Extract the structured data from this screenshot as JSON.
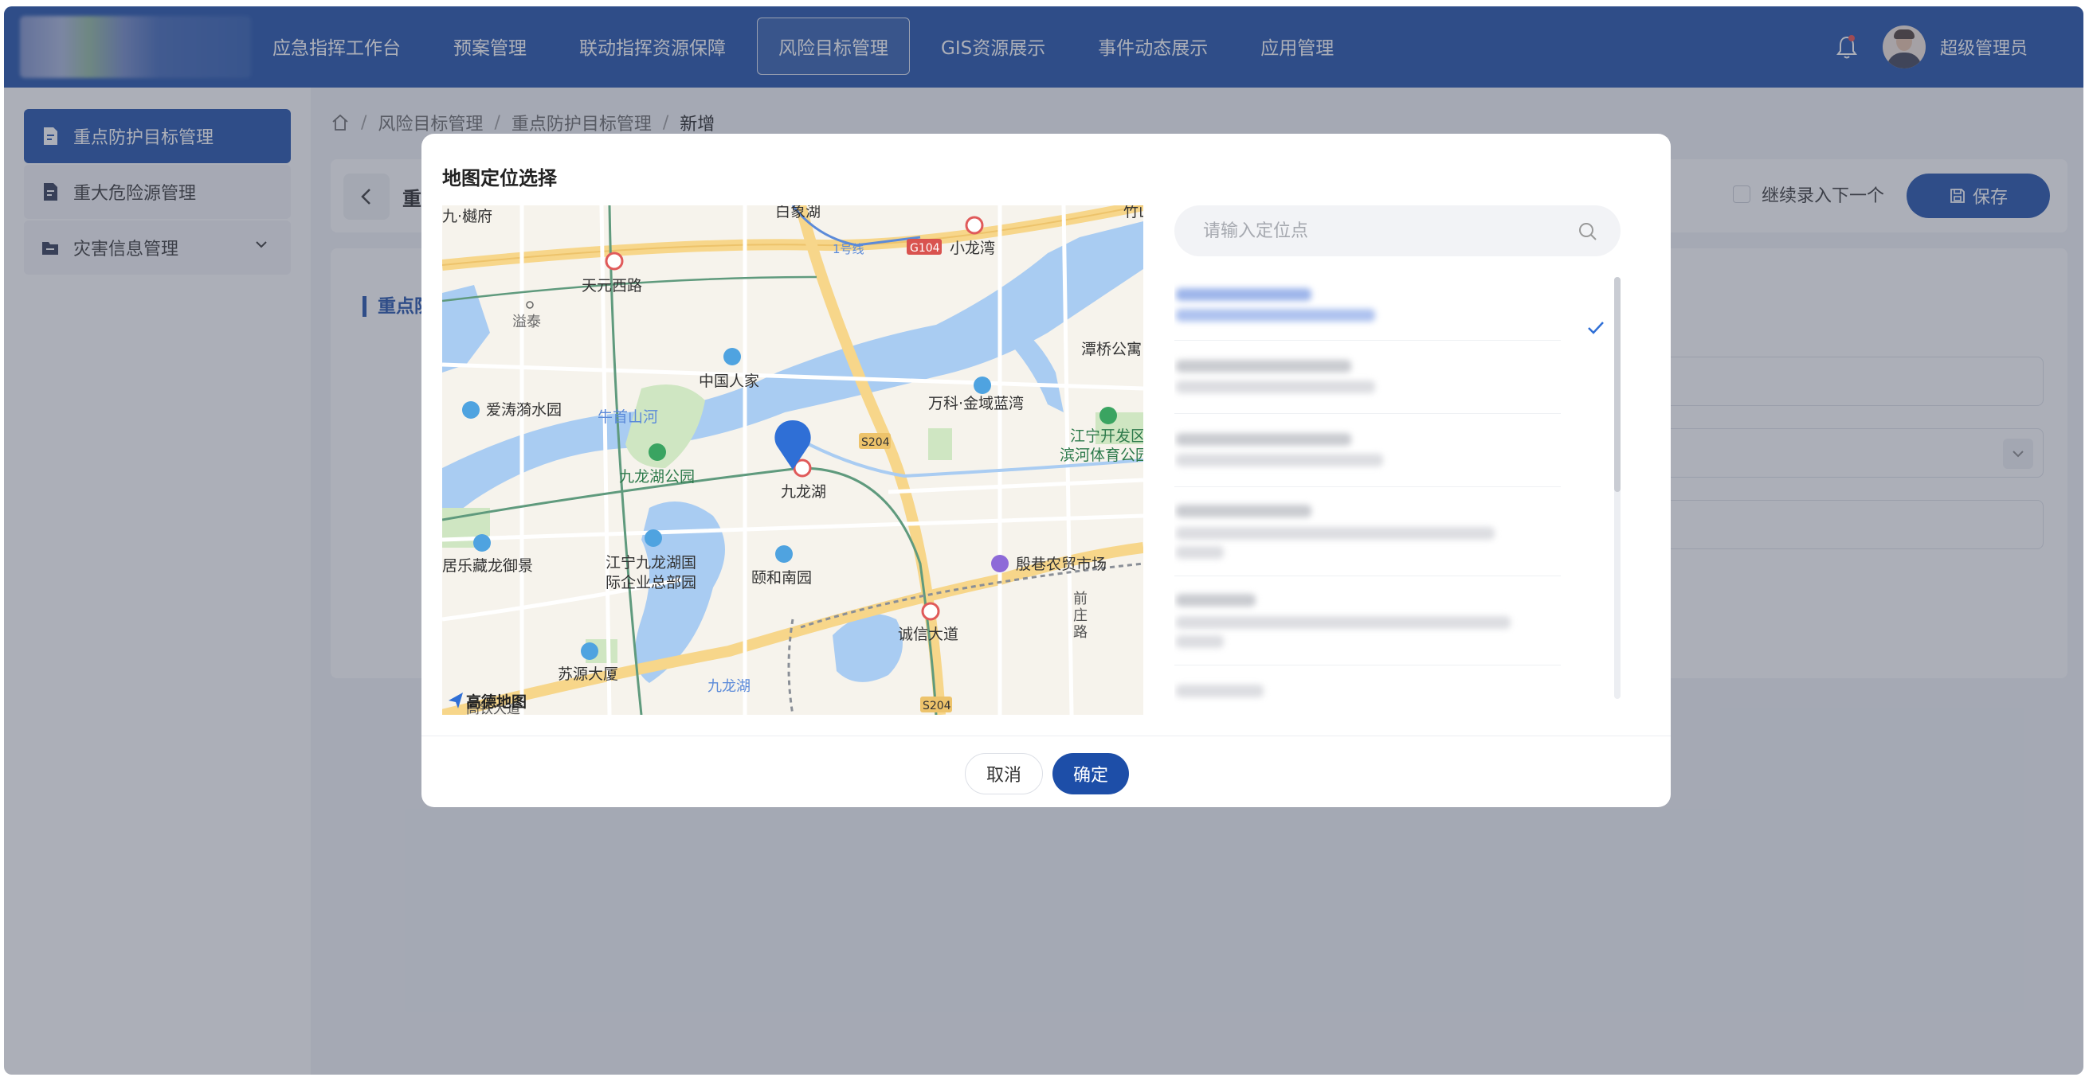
{
  "nav": {
    "items": [
      "应急指挥工作台",
      "预案管理",
      "联动指挥资源保障",
      "风险目标管理",
      "GIS资源展示",
      "事件动态展示",
      "应用管理"
    ],
    "active": "风险目标管理"
  },
  "user": {
    "name": "超级管理员",
    "avatar": "avatar-icon"
  },
  "sidebar": {
    "items": [
      {
        "label": "重点防护目标管理",
        "icon": "document-icon",
        "active": true
      },
      {
        "label": "重大危险源管理",
        "icon": "document-icon",
        "active": false
      },
      {
        "label": "灾害信息管理",
        "icon": "folder-icon",
        "active": false,
        "expandable": true
      }
    ]
  },
  "breadcrumb": [
    "风险目标管理",
    "重点防护目标管理",
    "新增"
  ],
  "page_header": {
    "title": "重",
    "continue_label": "继续录入下一个",
    "save_label": "保存"
  },
  "form": {
    "section_title": "重点防"
  },
  "dialog": {
    "title": "地图定位选择",
    "search_placeholder": "请输入定位点",
    "cancel_label": "取消",
    "confirm_label": "确定",
    "selected_index": 0
  },
  "map": {
    "provider": "高德地图",
    "labels": {
      "a": "九·樾府",
      "b": "白象湖",
      "c": "竹山",
      "d": "天元西路",
      "e": "溢泰",
      "f": "小龙湾",
      "g": "1号线",
      "h": "G104",
      "i": "中国人家",
      "j": "爱涛漪水园",
      "k": "牛首山河",
      "l": "万科·金域蓝湾",
      "m": "潭桥公寓",
      "n": "S204",
      "o": "九龙湖公园",
      "p": "九龙湖",
      "q": "江宁开发区",
      "r": "滨河体育公园",
      "s": "居乐藏龙御景",
      "t": "江宁九龙湖国",
      "u": "际企业总部园",
      "v": "颐和南园",
      "w": "殷巷农贸市场",
      "x": "诚信大道",
      "y": "前",
      "z": "庄",
      "aa": "路",
      "ab": "苏源大厦",
      "ac": "九龙湖",
      "ad": "S204",
      "ae": "高铁大道"
    }
  },
  "colors": {
    "primary": "#1d4ea8",
    "map_water": "#a9ccf2",
    "map_road": "#f7d68a"
  }
}
